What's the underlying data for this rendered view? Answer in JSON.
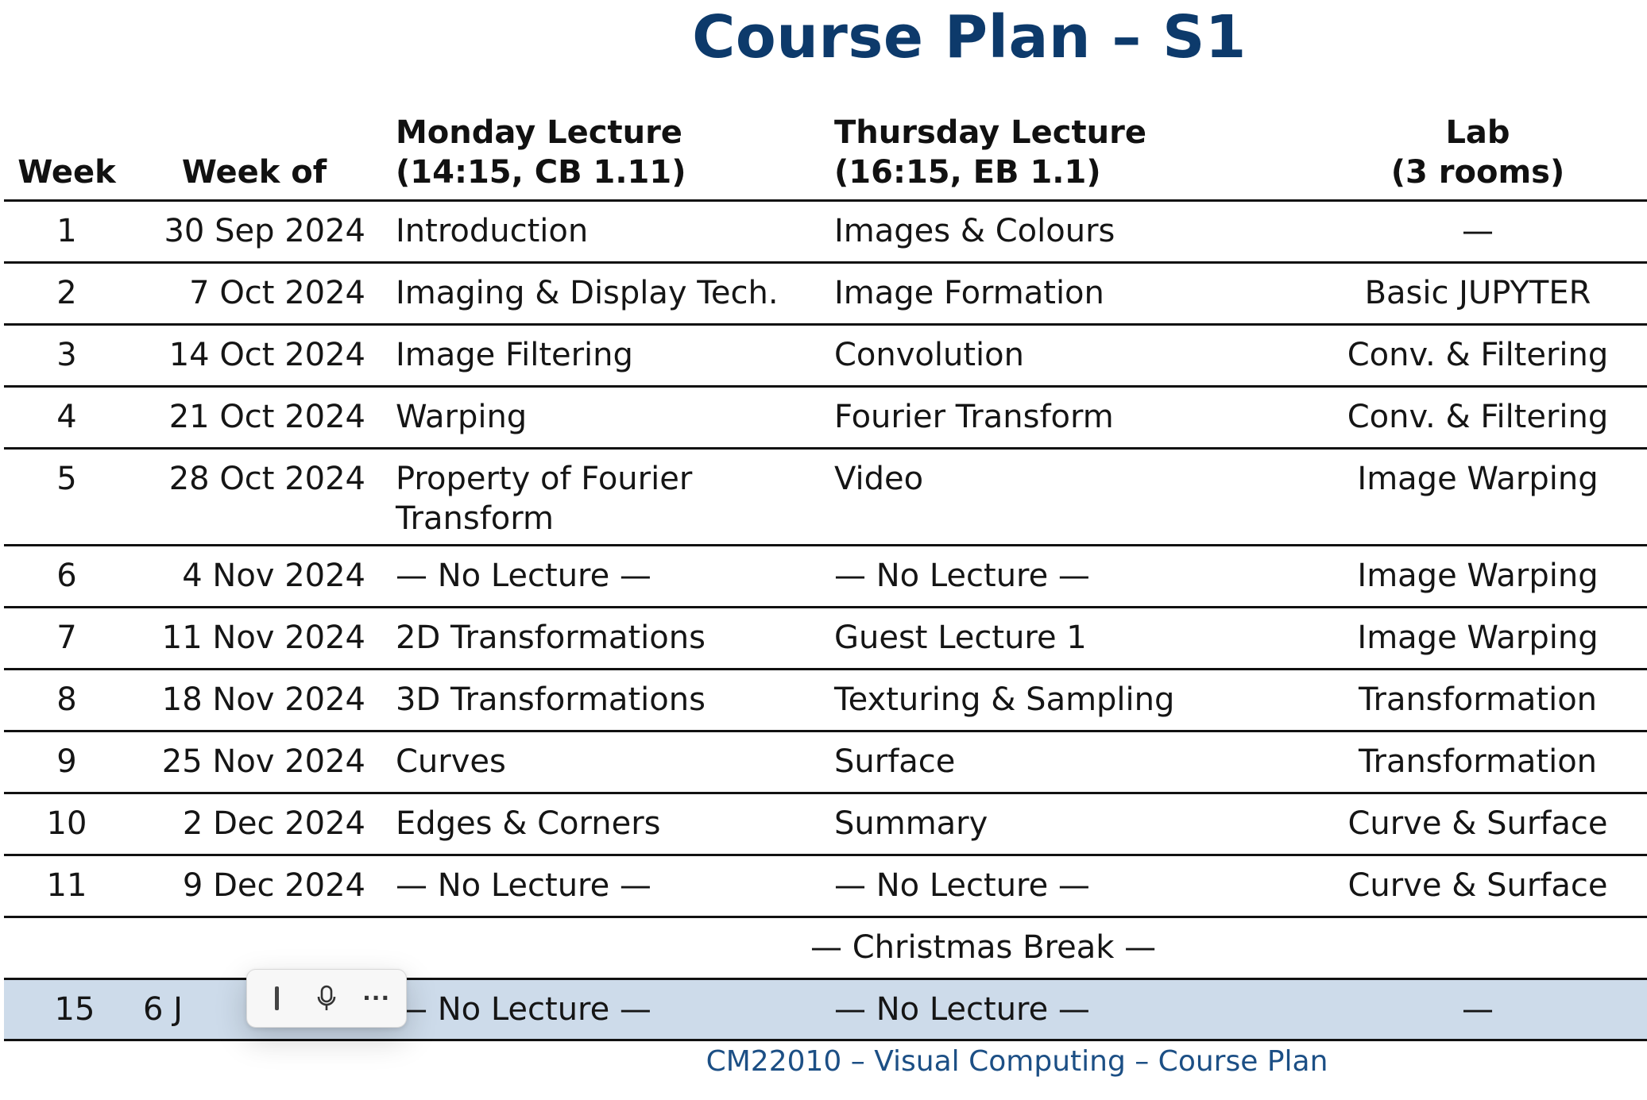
{
  "title": "Course Plan – S1",
  "header": {
    "week": "Week",
    "week_of": "Week of",
    "monday_line1": "Monday Lecture",
    "monday_line2": "(14:15, CB 1.11)",
    "thursday_line1": "Thursday Lecture",
    "thursday_line2": "(16:15, EB 1.1)",
    "lab_line1": "Lab",
    "lab_line2": "(3 rooms)"
  },
  "rows": [
    {
      "week": "1",
      "week_of": "30 Sep 2024",
      "monday": "Introduction",
      "thursday": "Images & Colours",
      "lab": "—"
    },
    {
      "week": "2",
      "week_of": "7 Oct 2024",
      "monday": "Imaging & Display Tech.",
      "thursday": "Image Formation",
      "lab": "Basic JUPYTER"
    },
    {
      "week": "3",
      "week_of": "14 Oct 2024",
      "monday": "Image Filtering",
      "thursday": "Convolution",
      "lab": "Conv. & Filtering"
    },
    {
      "week": "4",
      "week_of": "21 Oct 2024",
      "monday": "Warping",
      "thursday": "Fourier Transform",
      "lab": "Conv. & Filtering"
    },
    {
      "week": "5",
      "week_of": "28 Oct 2024",
      "monday": "Property of Fourier Transform",
      "thursday": "Video",
      "lab": "Image Warping"
    },
    {
      "week": "6",
      "week_of": "4 Nov 2024",
      "monday": "— No Lecture —",
      "thursday": "— No Lecture —",
      "lab": "Image Warping"
    },
    {
      "week": "7",
      "week_of": "11 Nov 2024",
      "monday": "2D Transformations",
      "thursday": "Guest Lecture 1",
      "lab": "Image Warping"
    },
    {
      "week": "8",
      "week_of": "18 Nov 2024",
      "monday": "3D Transformations",
      "thursday": "Texturing & Sampling",
      "lab": "Transformation"
    },
    {
      "week": "9",
      "week_of": "25 Nov 2024",
      "monday": "Curves",
      "thursday": "Surface",
      "lab": "Transformation"
    },
    {
      "week": "10",
      "week_of": "2 Dec 2024",
      "monday": "Edges & Corners",
      "thursday": "Summary",
      "lab": "Curve & Surface"
    },
    {
      "week": "11",
      "week_of": "9 Dec 2024",
      "monday": "— No Lecture —",
      "thursday": "— No Lecture —",
      "lab": "Curve & Surface"
    }
  ],
  "break_row": "— Christmas Break —",
  "last_row": {
    "week": "15",
    "week_of": "6 J",
    "monday": "— No Lecture —",
    "thursday": "— No Lecture —",
    "lab": "—"
  },
  "footer": "CM22010 – Visual Computing – Course Plan",
  "colors": {
    "title": "#0d3a6b",
    "footer": "#1c4f85",
    "highlight_row": "#cddbea"
  },
  "toolbar": {
    "icons": [
      "text-cursor-icon",
      "microphone-icon",
      "more-icon"
    ]
  }
}
